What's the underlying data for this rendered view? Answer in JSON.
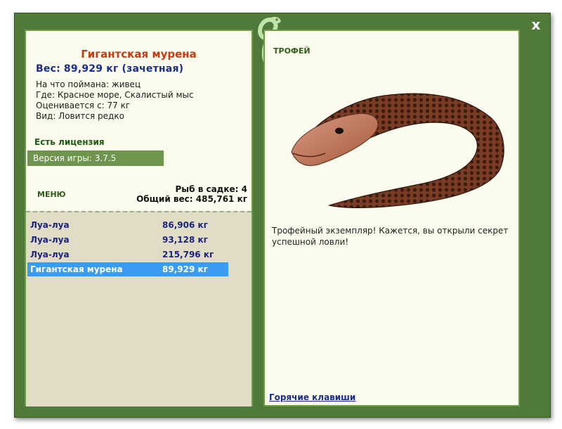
{
  "window": {
    "close_label": "x"
  },
  "fish": {
    "title": "Гигантская мурена",
    "weight_line": "Вес: 89,929 кг (зачетная)",
    "info": [
      "На что поймана: живец",
      "Где: Красное море, Скалистый мыс",
      "Оценивается с: 77 кг",
      "Вид: Ловится редко"
    ]
  },
  "license": "Есть лицензия",
  "version": "Версия игры: 3.7.5",
  "menu_label": "МЕНЮ",
  "keepnet": {
    "count": "Рыб в садке: 4",
    "total_weight": "Общий вес: 485,761 кг"
  },
  "fish_list": [
    {
      "name": "Луа-луа",
      "weight": "86,906 кг",
      "selected": false
    },
    {
      "name": "Луа-луа",
      "weight": "93,128 кг",
      "selected": false
    },
    {
      "name": "Луа-луа",
      "weight": "215,796 кг",
      "selected": false
    },
    {
      "name": "Гигантская мурена",
      "weight": "89,929 кг",
      "selected": true
    }
  ],
  "trophy": {
    "label": "ТРОФЕЙ",
    "image_icon": "moray-eel-image",
    "text": "Трофейный экземпляр! Кажется, вы открыли секрет успешной ловли!"
  },
  "hotkeys_link": "Горячие клавиши",
  "colors": {
    "frame": "#4f7a3a",
    "panel": "#fbfbee",
    "list_bg": "#e0dcc6",
    "selection": "#3a9cf0",
    "title_red": "#c23b12",
    "navy": "#1a2c8c"
  }
}
